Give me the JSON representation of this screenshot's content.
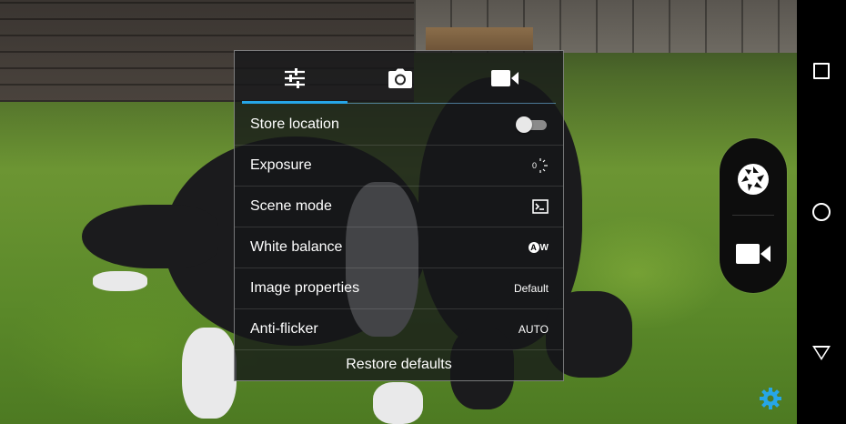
{
  "settings_panel": {
    "tabs": [
      {
        "name": "tab-general-settings",
        "icon": "sliders-icon",
        "active": true
      },
      {
        "name": "tab-photo-settings",
        "icon": "camera-icon",
        "active": false
      },
      {
        "name": "tab-video-settings",
        "icon": "videocam-icon",
        "active": false
      }
    ],
    "rows": [
      {
        "label": "Store location",
        "value": "",
        "control": "toggle",
        "toggle_on": false
      },
      {
        "label": "Exposure",
        "value": "0",
        "control": "exposure-icon"
      },
      {
        "label": "Scene mode",
        "value": "",
        "control": "scene-mode-icon"
      },
      {
        "label": "White balance",
        "value": "AW",
        "control": "white-balance-auto-icon"
      },
      {
        "label": "Image properties",
        "value": "Default",
        "control": "text"
      },
      {
        "label": "Anti-flicker",
        "value": "AUTO",
        "control": "text"
      }
    ],
    "restore_label": "Restore defaults"
  },
  "capture_controls": {
    "shutter_icon": "shutter-icon",
    "video_icon": "videocam-icon"
  },
  "navigation_bar": {
    "buttons": [
      "recent-apps-icon",
      "home-icon",
      "back-icon"
    ]
  },
  "colors": {
    "accent": "#26a6e8",
    "panel_bg": "#141618",
    "navbar_bg": "#000000",
    "capsule_bg": "#0d0d0d"
  }
}
